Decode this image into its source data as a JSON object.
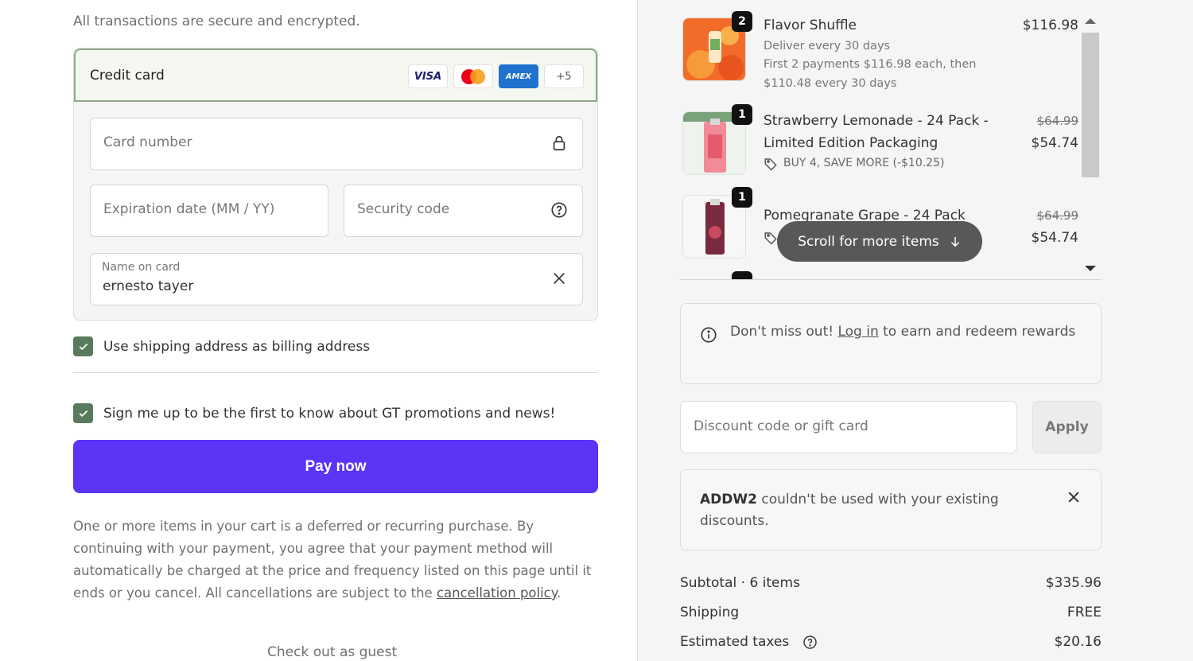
{
  "payment": {
    "secure_note": "All transactions are secure and encrypted.",
    "method_title": "Credit card",
    "card_brands": [
      "VISA",
      "AMEX"
    ],
    "more_brands": "+5",
    "card_number_placeholder": "Card number",
    "expiry_placeholder": "Expiration date (MM / YY)",
    "security_placeholder": "Security code",
    "name_label": "Name on card",
    "name_value": "ernesto tayer",
    "billing_checkbox_label": "Use shipping address as billing address",
    "newsletter_label": "Sign me up to be the first to know about GT promotions and news!",
    "pay_button": "Pay now",
    "legal_text": "One or more items in your cart is a deferred or recurring purchase. By continuing with your payment, you agree that your payment method will automatically be charged at the price and frequency listed on this page until it ends or you cancel. All cancellations are subject to the ",
    "legal_link": "cancellation policy",
    "legal_end": ".",
    "guest_link": "Check out as guest"
  },
  "cart": {
    "items": [
      {
        "qty": "2",
        "name": "Flavor Shuffle",
        "sub1": "Deliver every 30 days",
        "sub2": "First 2 payments $116.98 each, then",
        "sub3": "$110.48 every 30 days",
        "price": "$116.98"
      },
      {
        "qty": "1",
        "name_line1": "Strawberry Lemonade - 24 Pack -",
        "name_line2": "Limited Edition Packaging",
        "promo": "BUY 4, SAVE MORE (-$10.25)",
        "old_price": "$64.99",
        "price": "$54.74"
      },
      {
        "qty": "1",
        "name": "Pomegranate Grape - 24 Pack",
        "old_price": "$64.99",
        "price": "$54.74"
      }
    ],
    "scroll_pill": "Scroll for more items",
    "rewards_prefix": "Don't miss out! ",
    "rewards_link": "Log in",
    "rewards_suffix": " to earn and redeem rewards",
    "discount_placeholder": "Discount code or gift card",
    "apply_button": "Apply",
    "notice_code": "ADDW2",
    "notice_text": " couldn't be used with your existing discounts.",
    "subtotal_label": "Subtotal · 6 items",
    "subtotal_value": "$335.96",
    "shipping_label": "Shipping",
    "shipping_value": "FREE",
    "taxes_label": "Estimated taxes",
    "taxes_value": "$20.16"
  },
  "colors": {
    "pay_button": "#5b34f6",
    "checkbox": "#5a7a5e",
    "selected_border": "#8fa888"
  }
}
